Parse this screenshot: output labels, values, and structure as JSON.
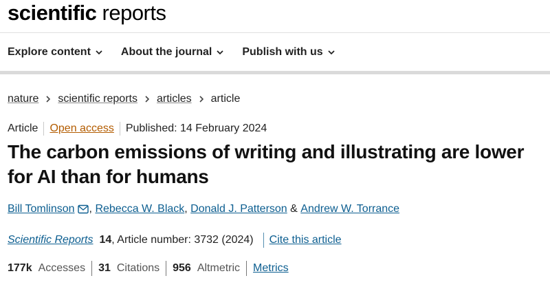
{
  "logo": {
    "bold": "scientific",
    "light": "reports"
  },
  "nav": {
    "items": [
      {
        "label": "Explore content"
      },
      {
        "label": "About the journal"
      },
      {
        "label": "Publish with us"
      }
    ]
  },
  "breadcrumb": {
    "items": [
      "nature",
      "scientific reports",
      "articles"
    ],
    "current": "article"
  },
  "meta": {
    "type": "Article",
    "access": "Open access",
    "published": "Published: 14 February 2024"
  },
  "title": "The carbon emissions of writing and illustrating are lower for AI than for humans",
  "authors": {
    "names": [
      "Bill Tomlinson",
      "Rebecca W. Black",
      "Donald J. Patterson",
      "Andrew W. Torrance"
    ],
    "separator": ",",
    "ampersand": "&"
  },
  "journal": {
    "name": "Scientific Reports",
    "volume": "14",
    "article_number": ", Article number: 3732 (2024)",
    "cite": "Cite this article"
  },
  "metrics": {
    "accesses_value": "177k",
    "accesses_label": "Accesses",
    "citations_value": "31",
    "citations_label": "Citations",
    "altmetric_value": "956",
    "altmetric_label": "Altmetric",
    "link": "Metrics"
  },
  "colors": {
    "link": "#0c5e90",
    "open_access": "#b35c00"
  }
}
